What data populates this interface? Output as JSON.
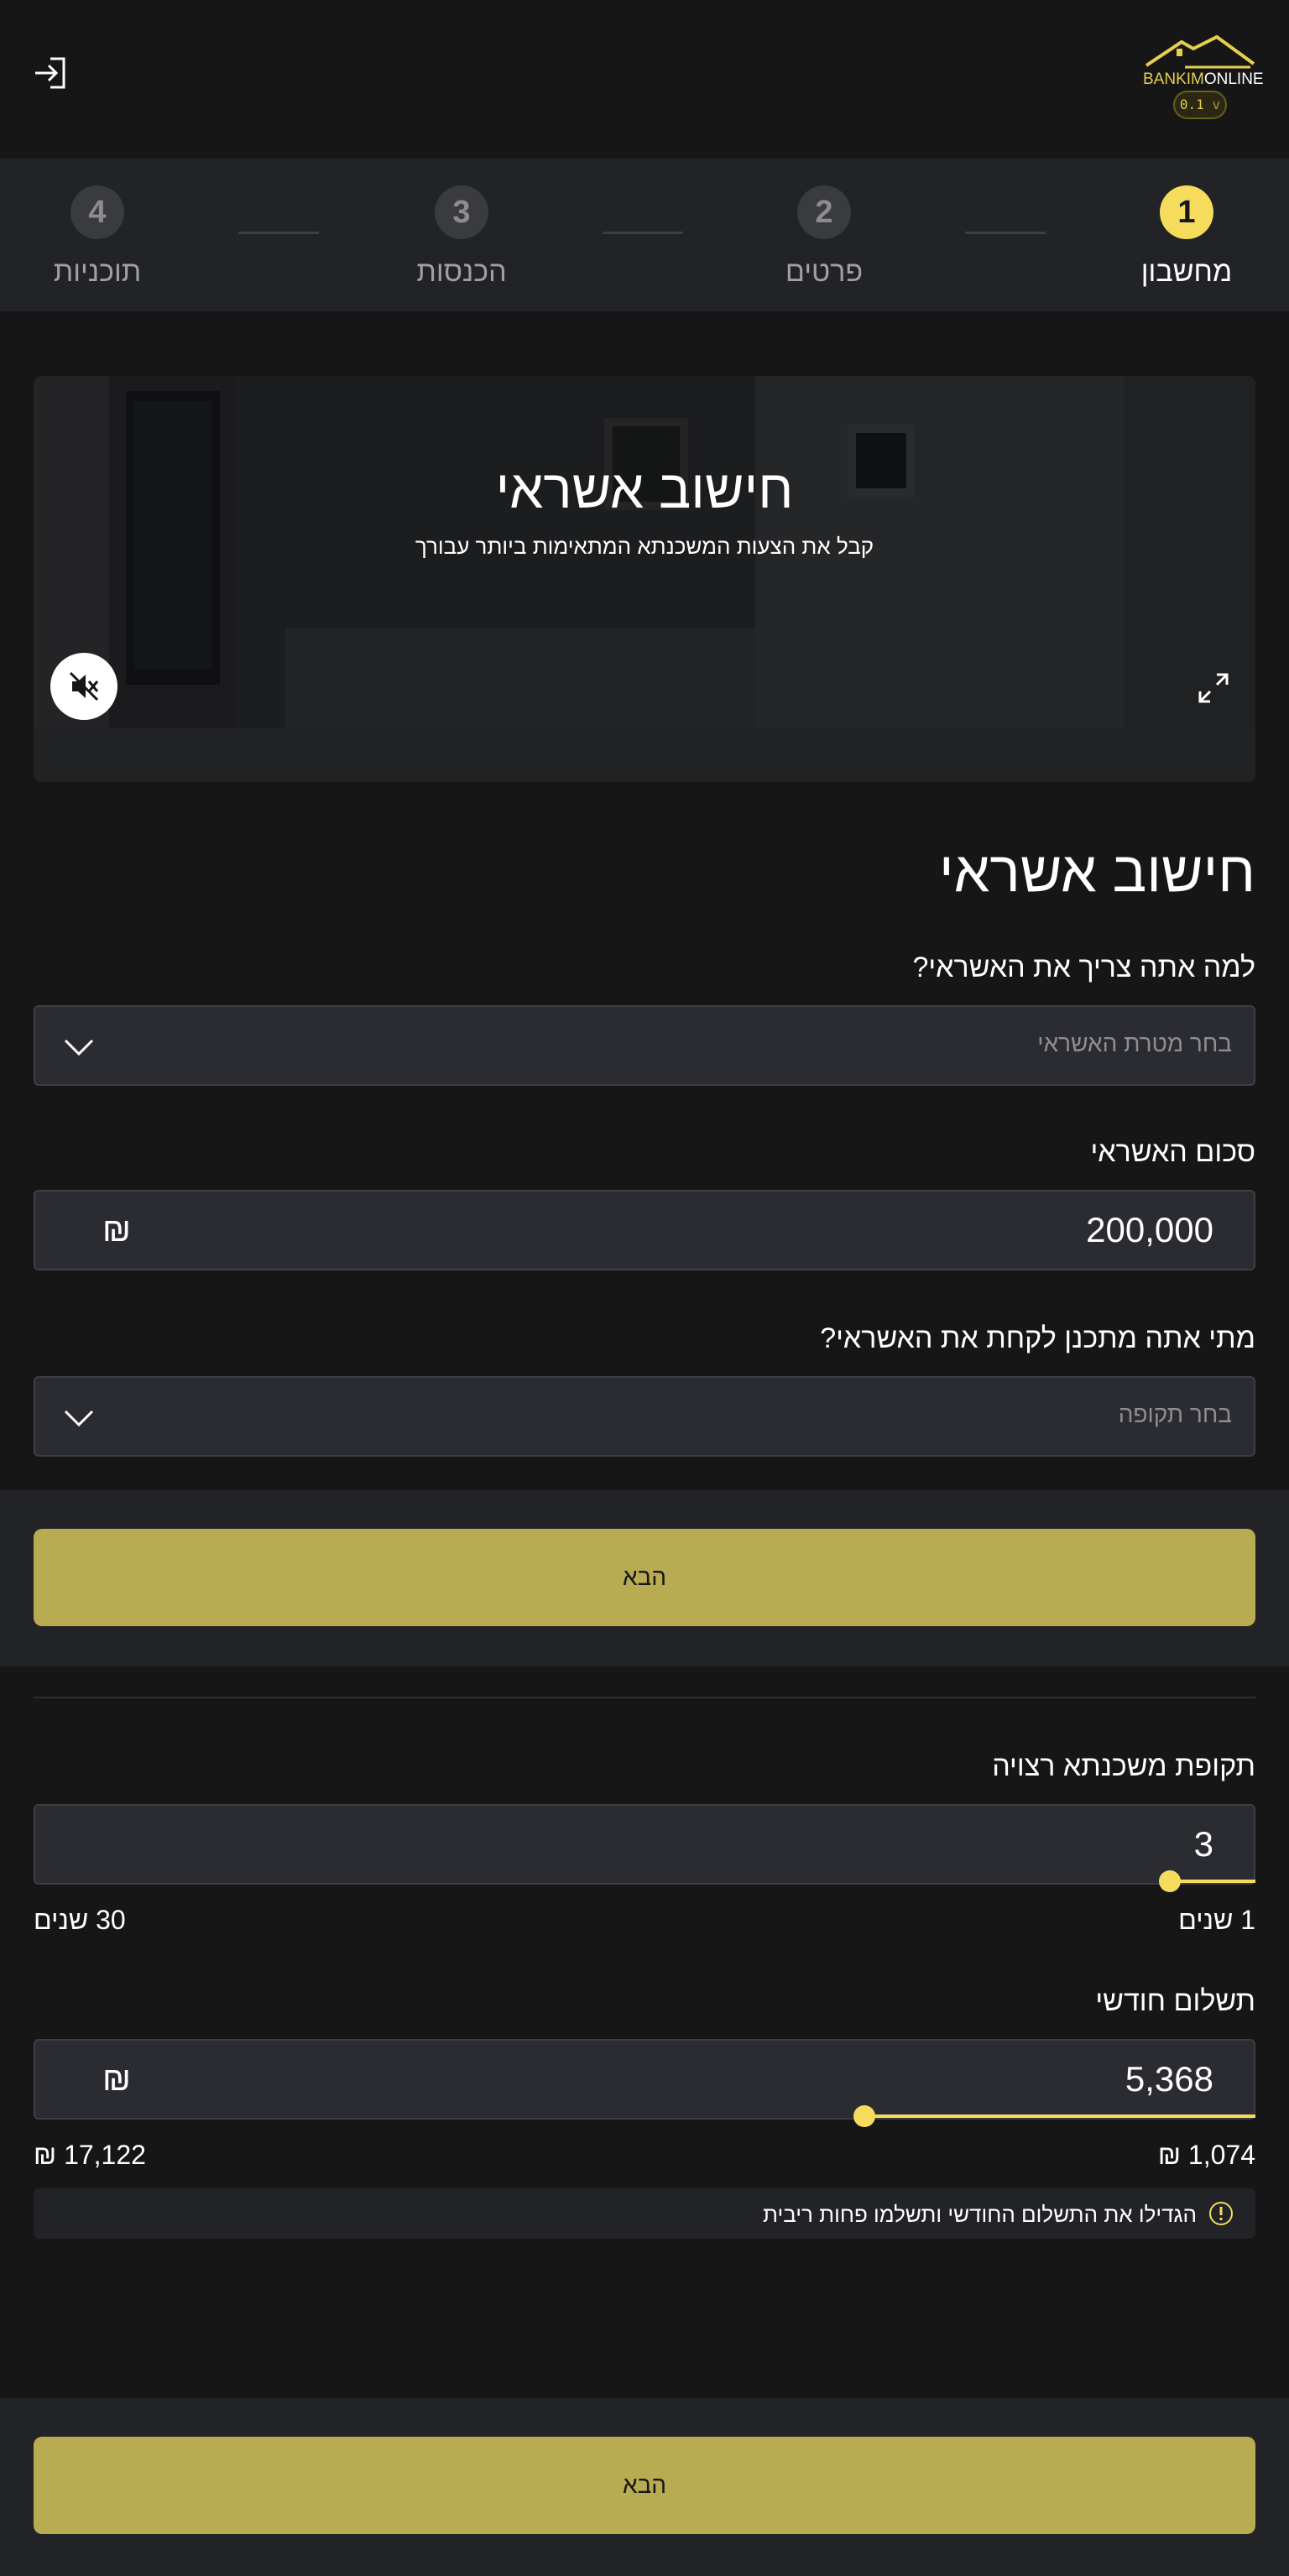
{
  "header": {
    "logo_brand_part1": "BANKIM",
    "logo_brand_part2": "ONLINE",
    "version": "0.1",
    "version_suffix": "v",
    "login_icon": "login-icon"
  },
  "stepper": {
    "steps": [
      {
        "number": "1",
        "label": "מחשבון",
        "active": true
      },
      {
        "number": "2",
        "label": "פרטים",
        "active": false
      },
      {
        "number": "3",
        "label": "הכנסות",
        "active": false
      },
      {
        "number": "4",
        "label": "תוכניות",
        "active": false
      }
    ]
  },
  "hero": {
    "title": "חישוב אשראי",
    "subtitle": "קבל את הצעות המשכנתא המתאימות ביותר עבורך",
    "mute_icon": "mute-icon",
    "expand_icon": "expand-icon"
  },
  "form": {
    "title": "חישוב אשראי",
    "purpose": {
      "label": "למה אתה צריך את האשראי?",
      "placeholder": "בחר מטרת האשראי"
    },
    "amount": {
      "label": "סכום האשראי",
      "value": "200,000",
      "currency": "₪"
    },
    "timing": {
      "label": "מתי אתה מתכנן לקחת את האשראי?",
      "placeholder": "בחר תקופה"
    },
    "next_label": "הבא"
  },
  "mortgage_period": {
    "label": "תקופת משכנתא רצויה",
    "value": "3",
    "min_label": "1 שנים",
    "max_label": "30 שנים",
    "slider_fraction": 0.07
  },
  "monthly_payment": {
    "label": "תשלום חודשי",
    "value": "5,368",
    "currency": "₪",
    "min_label": "1,074 ₪",
    "max_label": "17,122 ₪",
    "slider_fraction": 0.32
  },
  "info": {
    "text": "הגדילו את התשלום החודשי ותשלמו פחות ריבית",
    "icon": "info-icon"
  },
  "footer": {
    "next_label": "הבא"
  },
  "colors": {
    "accent": "#f5dc5c",
    "button": "#b8ab52",
    "background": "#161616",
    "panel": "#222327",
    "input": "#2b2c31"
  }
}
